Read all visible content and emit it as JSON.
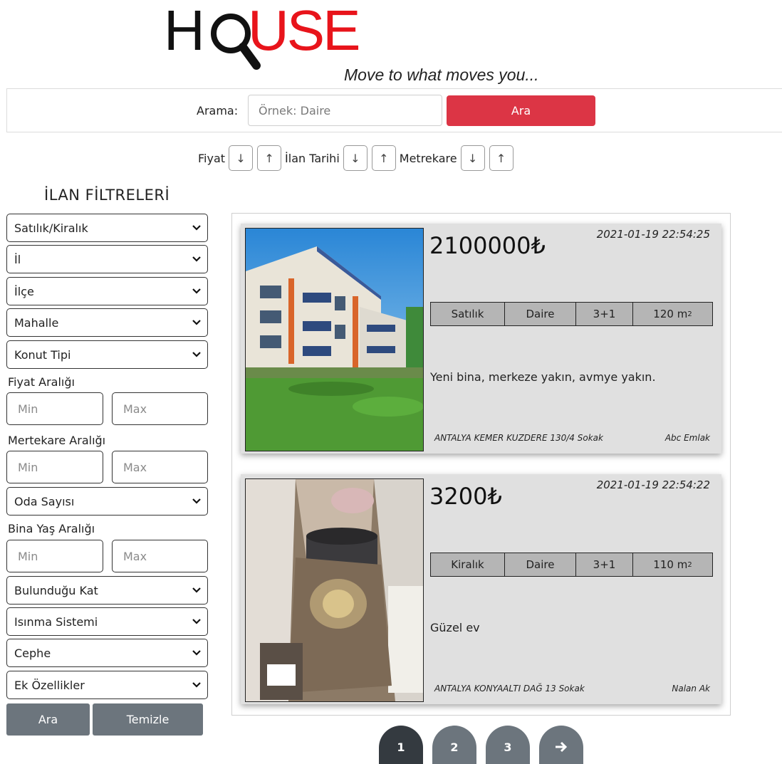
{
  "brand": {
    "logo_h": "H",
    "logo_use": "USE",
    "tagline": "Move to what moves you..."
  },
  "search": {
    "label": "Arama:",
    "placeholder": "Örnek: Daire",
    "button": "Ara"
  },
  "sort": {
    "price_label": "Fiyat",
    "date_label": "İlan Tarihi",
    "area_label": "Metrekare",
    "desc_arrow": "↓",
    "asc_arrow": "↑"
  },
  "filters": {
    "title": "İLAN FİLTRELERİ",
    "listing_type": "Satılık/Kiralık",
    "city": "İl",
    "district": "İlçe",
    "neighborhood": "Mahalle",
    "housing_type": "Konut Tipi",
    "price_range_label": "Fiyat Aralığı",
    "area_range_label": "Mertekare Aralığı",
    "room_count": "Oda Sayısı",
    "building_age_label": "Bina Yaş Aralığı",
    "floor": "Bulunduğu Kat",
    "heating": "Isınma Sistemi",
    "facade": "Cephe",
    "extras": "Ek Özellikler",
    "min_placeholder": "Min",
    "max_placeholder": "Max",
    "apply_button": "Ara",
    "clear_button": "Temizle"
  },
  "listings": [
    {
      "price": "2100000₺",
      "date": "2021-01-19 22:54:25",
      "status": "Satılık",
      "type": "Daire",
      "rooms": "3+1",
      "area": "120 m",
      "area_unit_sup": "2",
      "description": "Yeni bina, merkeze yakın, avmye yakın.",
      "address": "ANTALYA KEMER KUZDERE 130/4 Sokak",
      "owner": "Abc Emlak"
    },
    {
      "price": "3200₺",
      "date": "2021-01-19 22:54:22",
      "status": "Kiralık",
      "type": "Daire",
      "rooms": "3+1",
      "area": "110 m",
      "area_unit_sup": "2",
      "description": "Güzel ev",
      "address": "ANTALYA KONYAALTI DAĞ 13 Sokak",
      "owner": "Nalan Ak"
    }
  ],
  "pagination": {
    "pages": [
      "1",
      "2",
      "3"
    ],
    "next_icon": "arrow-right-icon",
    "active_page": "1"
  },
  "colors": {
    "brand_red": "#e8141b",
    "search_button": "#dc3545",
    "filter_button": "#6c757d",
    "page_active": "#343a40",
    "page_inactive": "#6c757d"
  }
}
